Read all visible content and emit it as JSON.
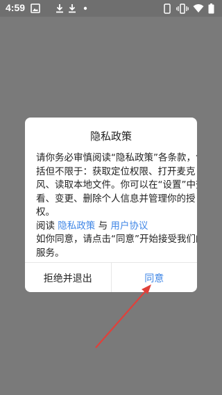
{
  "status_bar": {
    "time": "4:59",
    "icons": [
      "image-icon",
      "download-icon",
      "download-icon",
      "notification-dot-icon",
      "phone-icon",
      "vibrate-icon",
      "wifi-icon",
      "battery-icon"
    ]
  },
  "dialog": {
    "title": "隐私政策",
    "paragraph_lines": [
      "请你务必审慎阅读“隐私政策”各条款，包",
      "括但不限于：获取定位权限、打开麦克",
      "风、读取本地文件。你可以在“设置”中查",
      "看、变更、删除个人信息并管理你的授",
      "权。"
    ],
    "read_prefix": "阅读",
    "privacy_link": "隐私政策",
    "and_text": "与",
    "user_agreement_link": "用户协议",
    "agree_lines": [
      "如你同意，请点击“同意”开始接受我们的",
      "服务。"
    ],
    "reject_button": "拒绝并退出",
    "agree_button": "同意"
  },
  "colors": {
    "overlay": "#7a7a7a",
    "link": "#3f86e6",
    "annotation_arrow": "#e0403a"
  }
}
